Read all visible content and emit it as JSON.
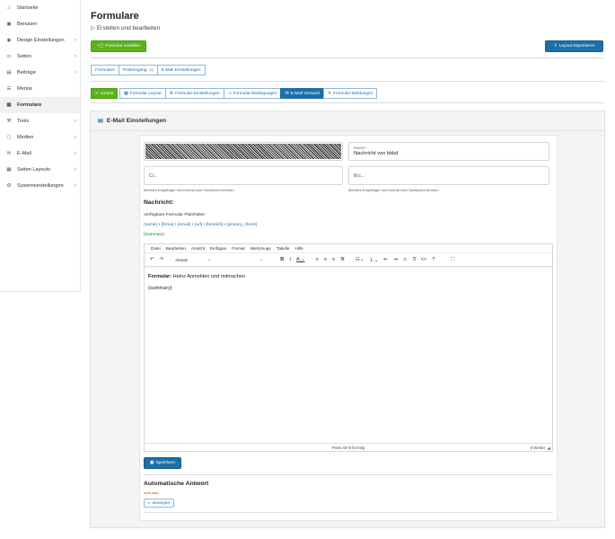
{
  "sidebar": {
    "items": [
      {
        "label": "Startseite",
        "icon": "home-icon",
        "glyph": "⌂",
        "chevron": false,
        "active": false
      },
      {
        "label": "Benutzer",
        "icon": "user-card-icon",
        "glyph": "▣",
        "chevron": false,
        "active": false
      },
      {
        "label": "Design Einstellungen",
        "icon": "palette-icon",
        "glyph": "◉",
        "chevron": true,
        "active": false
      },
      {
        "label": "Seiten",
        "icon": "page-icon",
        "glyph": "▭",
        "chevron": true,
        "active": false
      },
      {
        "label": "Beiträge",
        "icon": "posts-icon",
        "glyph": "▤",
        "chevron": true,
        "active": false
      },
      {
        "label": "Menüs",
        "icon": "menu-icon",
        "glyph": "☰",
        "chevron": false,
        "active": false
      },
      {
        "label": "Formulare",
        "icon": "form-icon",
        "glyph": "▦",
        "chevron": false,
        "active": true
      },
      {
        "label": "Tools",
        "icon": "tools-icon",
        "glyph": "⚒",
        "chevron": true,
        "active": false
      },
      {
        "label": "Medien",
        "icon": "media-icon",
        "glyph": "▢",
        "chevron": true,
        "active": false
      },
      {
        "label": "E-Mail",
        "icon": "mail-icon",
        "glyph": "✉",
        "chevron": true,
        "active": false
      },
      {
        "label": "Seiten Layouts",
        "icon": "layout-icon",
        "glyph": "▦",
        "chevron": true,
        "active": false
      },
      {
        "label": "Systemeinstellungen",
        "icon": "gear-icon",
        "glyph": "⚙",
        "chevron": true,
        "active": false
      }
    ]
  },
  "header": {
    "title": "Formulare",
    "subtitle": "Erstellen und bearbeiten",
    "subtitle_marker": "▷"
  },
  "actions": {
    "create_form": "Formular erstellen",
    "import_layout": "Layout importieren"
  },
  "main_tabs": [
    {
      "label": "Formulare",
      "badge": ""
    },
    {
      "label": "Posteingang",
      "badge": "(0)"
    },
    {
      "label": "E-Mail Einstellungen",
      "badge": ""
    }
  ],
  "sub_tabs": {
    "back": "zurück",
    "items": [
      {
        "label": "Formular Layout",
        "icon": "▦",
        "selected": false
      },
      {
        "label": "Formular-Einstellungen",
        "icon": "⚙",
        "selected": false
      },
      {
        "label": "Formular Bedingungen",
        "icon": "⇢",
        "selected": false
      },
      {
        "label": "E-Mail Versand",
        "icon": "✉",
        "selected": true
      },
      {
        "label": "Formular Meldungen",
        "icon": "✕",
        "selected": false
      }
    ]
  },
  "panel": {
    "title": "E-Mail Einstellungen"
  },
  "email": {
    "subject_label": "Betreff *",
    "subject_value": "Nachricht von bkkd",
    "cc_placeholder": "Cc..",
    "bcc_placeholder": "Bcc..",
    "cc_hint": "Mehrere Empfänger mit Komma oder Semikolon trennen.",
    "bcc_hint": "Mehrere Empfänger mit Komma oder Semikolon trennen."
  },
  "message": {
    "heading": "Nachricht:",
    "placeholders_label": "Verfügbare Formular Platzhalter:",
    "placeholders_line": "{name} • {firma} • {email} • {url} • {bereich} • {privacy_check}",
    "summary_placeholder": "{summary}"
  },
  "editor": {
    "menus": [
      "Datei",
      "Bearbeiten",
      "Ansicht",
      "Einfügen",
      "Format",
      "Werkzeuge",
      "Tabelle",
      "Hilfe"
    ],
    "block_format": "Absatz",
    "content_bold": "Formular:",
    "content_rest": " Heinz Anmelden und mitmachen",
    "content_line2": "{summary}",
    "status_help": "Press Alt+0 for help",
    "word_count": "6 Wörter"
  },
  "save_button": "Speichern",
  "auto_reply": {
    "heading": "Automatische Antwort",
    "status": "nicht aktiv",
    "show_button": "anzeigen"
  },
  "colors": {
    "green": "#5cb31a",
    "blue": "#1d6fa8",
    "red": "#d0342c"
  }
}
